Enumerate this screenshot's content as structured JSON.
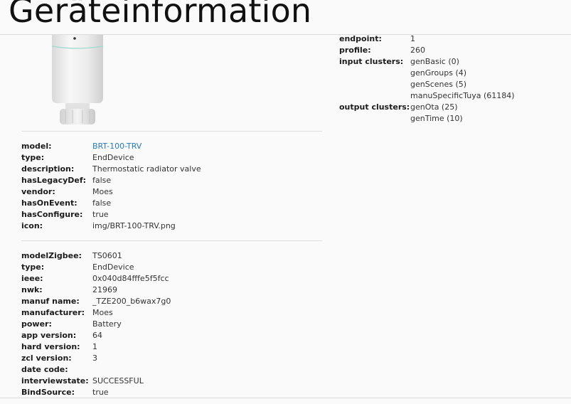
{
  "header": {
    "title": "Geräteinformation"
  },
  "endpoint_info": {
    "endpoint": {
      "label": "endpoint:",
      "value": "1"
    },
    "profile": {
      "label": "profile:",
      "value": "260"
    },
    "input_clusters": {
      "label": "input clusters:",
      "values": [
        "genBasic (0)",
        "genGroups (4)",
        "genScenes (5)",
        "manuSpecificTuya (61184)"
      ]
    },
    "output_clusters": {
      "label": "output clusters:",
      "values": [
        "genOta (25)",
        "genTime (10)"
      ]
    }
  },
  "definition": [
    {
      "label": "model:",
      "value": "BRT-100-TRV"
    },
    {
      "label": "type:",
      "value": "EndDevice"
    },
    {
      "label": "description:",
      "value": "Thermostatic radiator valve"
    },
    {
      "label": "hasLegacyDef:",
      "value": "false"
    },
    {
      "label": "vendor:",
      "value": "Moes"
    },
    {
      "label": "hasOnEvent:",
      "value": "false"
    },
    {
      "label": "hasConfigure:",
      "value": "true"
    },
    {
      "label": "icon:",
      "value": "img/BRT-100-TRV.png"
    }
  ],
  "zigbee": [
    {
      "label": "modelZigbee:",
      "value": "TS0601"
    },
    {
      "label": "type:",
      "value": "EndDevice"
    },
    {
      "label": "ieee:",
      "value": "0x040d84fffe5f5fcc"
    },
    {
      "label": "nwk:",
      "value": "21969"
    },
    {
      "label": "manuf name:",
      "value": "_TZE200_b6wax7g0"
    },
    {
      "label": "manufacturer:",
      "value": "Moes"
    },
    {
      "label": "power:",
      "value": "Battery"
    },
    {
      "label": "app version:",
      "value": "64"
    },
    {
      "label": "hard version:",
      "value": "1"
    },
    {
      "label": "zcl version:",
      "value": "3"
    },
    {
      "label": "date code:",
      "value": ""
    },
    {
      "label": "interviewstate:",
      "value": "SUCCESSFUL"
    },
    {
      "label": "BindSource:",
      "value": "true"
    }
  ]
}
